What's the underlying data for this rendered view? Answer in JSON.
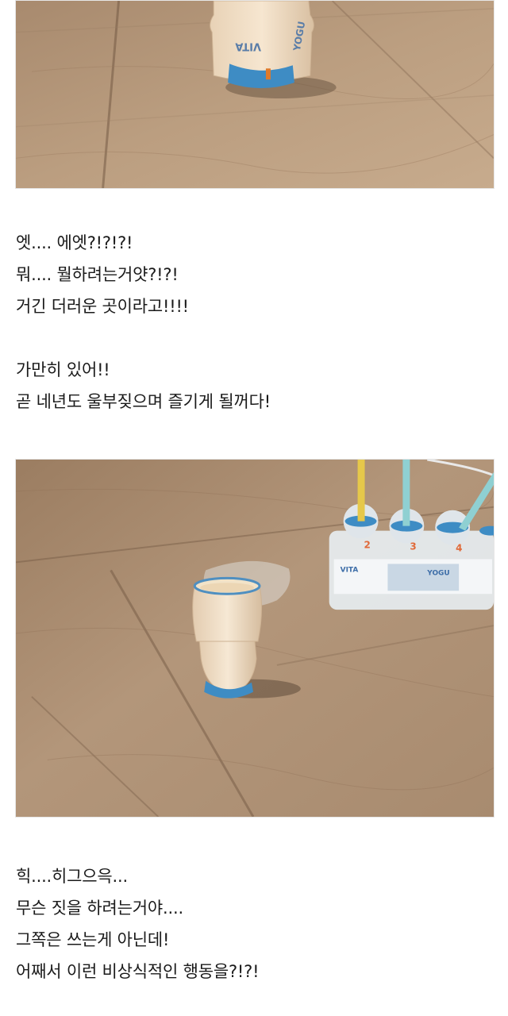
{
  "post": {
    "block1": [
      "엣.... 에엣?!?!?!",
      "뭐.... 뭘하려는거얏?!?!",
      "거긴 더러운 곳이라고!!!!"
    ],
    "block2": [
      "가만히 있어!!",
      "곧 네년도 울부짖으며 즐기게 될꺼다!"
    ],
    "block3": [
      "힉....히그으윽...",
      "무슨 짓을 하려는거야....",
      "그쪽은 쓰는게 아닌데!",
      "어째서 이런 비상식적인 행동을?!?!"
    ]
  },
  "photos": {
    "photo1": {
      "bottle_label_1": "VITA",
      "bottle_label_2": "YOGU"
    },
    "photo2": {
      "pack_label_1": "VITA",
      "pack_label_2": "YOGU",
      "straw_numbers": [
        "2",
        "3",
        "4"
      ]
    }
  },
  "colors": {
    "wood_light": "#b89a7c",
    "wood_dark": "#8f7259",
    "cap_blue": "#3e8cc4",
    "drink_cream": "#f1dcc0"
  }
}
